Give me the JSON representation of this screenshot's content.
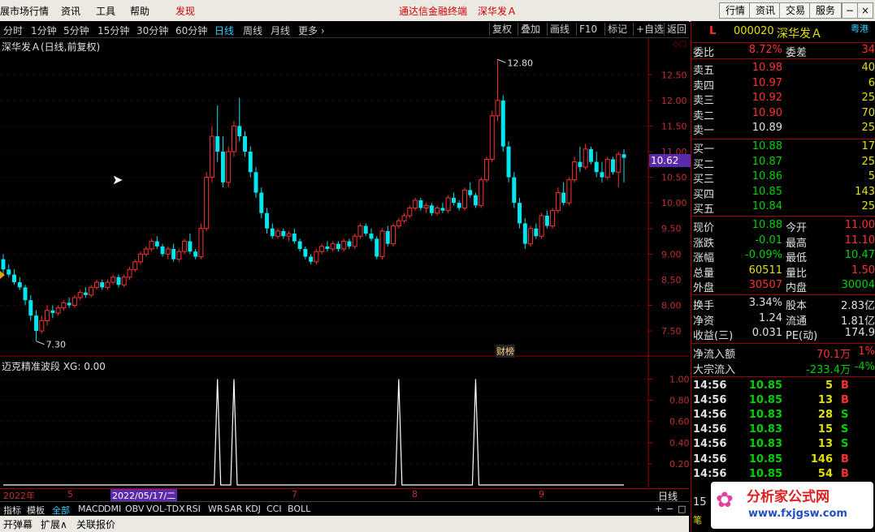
{
  "menu": {
    "items": [
      "展市场行情",
      "资讯",
      "工具",
      "帮助"
    ],
    "discover": "发现",
    "center_title": "通达信金融终端",
    "center_stock": "深华发Ａ",
    "buttons": [
      "行情",
      "资讯",
      "交易",
      "服务"
    ]
  },
  "periods": {
    "items": [
      "分时",
      "1分钟",
      "5分钟",
      "15分钟",
      "30分钟",
      "60分钟",
      "日线",
      "周线",
      "月线",
      "更多 ›"
    ],
    "active": "日线",
    "right_buttons": [
      "复权",
      "叠加",
      "画线",
      "F10",
      "标记",
      "+自选",
      "返回"
    ]
  },
  "main_chart": {
    "title": "深华发Ａ(日线,前复权)",
    "price_label": "10.62",
    "high_label": "12.80",
    "low_label": "7.30",
    "event_label": "财榜",
    "colors": {
      "up": "#ff3030",
      "down": "#00e5ee"
    }
  },
  "sub_chart": {
    "title": "迈克精准波段 XG: 0.00"
  },
  "chart_data": [
    {
      "type": "candlestick",
      "title": "深华发Ａ(日线,前复权)",
      "yticks": [
        7.5,
        8.0,
        8.5,
        9.0,
        9.5,
        10.0,
        10.5,
        11.0,
        11.5,
        12.0,
        12.5
      ],
      "ylim": [
        7.2,
        12.9
      ],
      "xticks": [
        "2022年",
        "5",
        "7",
        "8",
        "9"
      ],
      "annotations": [
        {
          "text": "12.80",
          "value": 12.8
        },
        {
          "text": "7.30",
          "value": 7.3
        },
        {
          "text": "10.62",
          "value": 10.62
        }
      ],
      "ohlc": [
        [
          8.9,
          9.0,
          8.6,
          8.7
        ],
        [
          8.7,
          8.8,
          8.55,
          8.6
        ],
        [
          8.6,
          8.7,
          8.4,
          8.45
        ],
        [
          8.45,
          8.55,
          8.3,
          8.35
        ],
        [
          8.35,
          8.4,
          8.0,
          8.1
        ],
        [
          8.1,
          8.2,
          7.7,
          7.8
        ],
        [
          7.8,
          7.9,
          7.3,
          7.5
        ],
        [
          7.5,
          7.8,
          7.45,
          7.7
        ],
        [
          7.7,
          8.0,
          7.6,
          7.9
        ],
        [
          7.9,
          8.0,
          7.75,
          7.85
        ],
        [
          7.85,
          8.0,
          7.8,
          7.95
        ],
        [
          7.95,
          8.1,
          7.9,
          8.05
        ],
        [
          8.05,
          8.15,
          7.95,
          8.0
        ],
        [
          8.0,
          8.2,
          7.95,
          8.15
        ],
        [
          8.15,
          8.3,
          8.1,
          8.25
        ],
        [
          8.25,
          8.35,
          8.15,
          8.2
        ],
        [
          8.2,
          8.4,
          8.15,
          8.35
        ],
        [
          8.35,
          8.5,
          8.3,
          8.45
        ],
        [
          8.45,
          8.5,
          8.3,
          8.35
        ],
        [
          8.35,
          8.5,
          8.3,
          8.45
        ],
        [
          8.45,
          8.6,
          8.4,
          8.55
        ],
        [
          8.55,
          8.6,
          8.35,
          8.4
        ],
        [
          8.4,
          8.6,
          8.35,
          8.55
        ],
        [
          8.55,
          8.75,
          8.5,
          8.7
        ],
        [
          8.7,
          8.9,
          8.65,
          8.85
        ],
        [
          8.85,
          9.05,
          8.8,
          9.0
        ],
        [
          9.0,
          9.15,
          8.95,
          9.1
        ],
        [
          9.1,
          9.3,
          9.05,
          9.25
        ],
        [
          9.25,
          9.35,
          9.1,
          9.15
        ],
        [
          9.15,
          9.2,
          8.95,
          9.0
        ],
        [
          9.0,
          9.15,
          8.9,
          9.1
        ],
        [
          9.1,
          9.2,
          8.85,
          8.9
        ],
        [
          8.9,
          9.1,
          8.85,
          9.05
        ],
        [
          9.05,
          9.3,
          9.0,
          9.25
        ],
        [
          9.25,
          9.4,
          9.0,
          9.05
        ],
        [
          9.05,
          9.1,
          8.9,
          8.95
        ],
        [
          8.95,
          9.6,
          8.9,
          9.5
        ],
        [
          9.5,
          10.6,
          9.45,
          10.5
        ],
        [
          10.5,
          11.5,
          10.4,
          11.3
        ],
        [
          11.3,
          11.9,
          10.8,
          11.0
        ],
        [
          11.0,
          11.3,
          10.3,
          10.4
        ],
        [
          10.4,
          11.1,
          10.3,
          11.0
        ],
        [
          11.0,
          11.6,
          10.9,
          11.5
        ],
        [
          11.5,
          12.05,
          11.2,
          11.3
        ],
        [
          11.3,
          11.4,
          10.9,
          11.0
        ],
        [
          11.0,
          11.1,
          10.5,
          10.6
        ],
        [
          10.6,
          10.7,
          10.1,
          10.2
        ],
        [
          10.2,
          10.3,
          9.7,
          9.8
        ],
        [
          9.8,
          9.9,
          9.4,
          9.5
        ],
        [
          9.5,
          9.6,
          9.3,
          9.35
        ],
        [
          9.35,
          9.5,
          9.3,
          9.45
        ],
        [
          9.45,
          9.5,
          9.3,
          9.35
        ],
        [
          9.35,
          9.45,
          9.25,
          9.4
        ],
        [
          9.4,
          9.5,
          9.2,
          9.25
        ],
        [
          9.25,
          9.3,
          9.05,
          9.1
        ],
        [
          9.1,
          9.15,
          8.9,
          8.95
        ],
        [
          8.95,
          9.0,
          8.8,
          8.85
        ],
        [
          8.85,
          9.1,
          8.8,
          9.05
        ],
        [
          9.05,
          9.2,
          9.0,
          9.15
        ],
        [
          9.15,
          9.25,
          9.05,
          9.1
        ],
        [
          9.1,
          9.25,
          9.05,
          9.2
        ],
        [
          9.2,
          9.25,
          9.05,
          9.1
        ],
        [
          9.1,
          9.3,
          9.05,
          9.25
        ],
        [
          9.25,
          9.3,
          9.1,
          9.15
        ],
        [
          9.15,
          9.4,
          9.1,
          9.35
        ],
        [
          9.35,
          9.6,
          9.3,
          9.55
        ],
        [
          9.55,
          9.6,
          9.35,
          9.4
        ],
        [
          9.4,
          9.5,
          9.25,
          9.3
        ],
        [
          9.3,
          9.35,
          8.9,
          8.95
        ],
        [
          8.95,
          9.5,
          8.9,
          9.45
        ],
        [
          9.45,
          9.55,
          9.15,
          9.2
        ],
        [
          9.2,
          9.6,
          9.15,
          9.55
        ],
        [
          9.55,
          9.7,
          9.5,
          9.65
        ],
        [
          9.65,
          9.8,
          9.6,
          9.75
        ],
        [
          9.75,
          9.95,
          9.7,
          9.9
        ],
        [
          9.9,
          10.1,
          9.85,
          10.05
        ],
        [
          10.05,
          10.1,
          9.85,
          9.9
        ],
        [
          9.9,
          10.0,
          9.8,
          9.95
        ],
        [
          9.95,
          10.0,
          9.75,
          9.8
        ],
        [
          9.8,
          9.95,
          9.75,
          9.9
        ],
        [
          9.9,
          10.0,
          9.8,
          9.85
        ],
        [
          9.85,
          10.15,
          9.8,
          10.1
        ],
        [
          10.1,
          10.2,
          9.95,
          10.0
        ],
        [
          10.0,
          10.05,
          9.85,
          9.9
        ],
        [
          9.9,
          10.3,
          9.85,
          10.25
        ],
        [
          10.25,
          10.4,
          10.1,
          10.15
        ],
        [
          10.15,
          10.2,
          9.9,
          9.95
        ],
        [
          9.95,
          10.5,
          9.9,
          10.45
        ],
        [
          10.45,
          10.9,
          10.4,
          10.85
        ],
        [
          10.85,
          11.8,
          10.8,
          11.7
        ],
        [
          11.7,
          12.8,
          11.6,
          12.0
        ],
        [
          12.0,
          12.1,
          11.0,
          11.1
        ],
        [
          11.1,
          11.2,
          10.4,
          10.5
        ],
        [
          10.5,
          10.6,
          9.9,
          10.0
        ],
        [
          10.0,
          10.1,
          9.5,
          9.6
        ],
        [
          9.6,
          9.7,
          9.1,
          9.2
        ],
        [
          9.2,
          9.55,
          9.15,
          9.5
        ],
        [
          9.5,
          9.6,
          9.3,
          9.35
        ],
        [
          9.35,
          9.8,
          9.3,
          9.75
        ],
        [
          9.75,
          9.85,
          9.5,
          9.55
        ],
        [
          9.55,
          9.9,
          9.5,
          9.85
        ],
        [
          9.85,
          10.3,
          9.8,
          10.2
        ],
        [
          10.2,
          10.4,
          9.95,
          10.0
        ],
        [
          10.0,
          10.5,
          9.95,
          10.45
        ],
        [
          10.45,
          10.9,
          10.4,
          10.8
        ],
        [
          10.8,
          11.1,
          10.6,
          10.7
        ],
        [
          10.7,
          11.15,
          10.65,
          11.05
        ],
        [
          11.05,
          11.1,
          10.75,
          10.8
        ],
        [
          10.8,
          11.0,
          10.5,
          10.6
        ],
        [
          10.6,
          10.8,
          10.4,
          10.5
        ],
        [
          10.5,
          10.9,
          10.45,
          10.85
        ],
        [
          10.85,
          10.9,
          10.55,
          10.6
        ],
        [
          10.6,
          11.0,
          10.3,
          10.95
        ],
        [
          10.95,
          11.05,
          10.4,
          10.88
        ]
      ]
    },
    {
      "type": "line",
      "title": "迈克精准波段 XG: 0.00",
      "yticks": [
        0.2,
        0.4,
        0.6,
        0.8,
        1.0
      ],
      "ylim": [
        0,
        1.05
      ],
      "spikes_at_bar": [
        39,
        42,
        72,
        86
      ],
      "values_baseline": 0
    }
  ],
  "right_panel": {
    "marker": "L",
    "code": "000020",
    "name": "深华发Ａ",
    "tag": "粤港",
    "weibi_label": "委比",
    "weibi_value": "8.72%",
    "weicha_label": "委差",
    "weicha_value": "34",
    "asks": [
      {
        "label": "卖五",
        "price": "10.98",
        "vol": "40"
      },
      {
        "label": "卖四",
        "price": "10.97",
        "vol": "6"
      },
      {
        "label": "卖三",
        "price": "10.92",
        "vol": "25"
      },
      {
        "label": "卖二",
        "price": "10.90",
        "vol": "70"
      },
      {
        "label": "卖一",
        "price": "10.89",
        "vol": "25"
      }
    ],
    "bids": [
      {
        "label": "买一",
        "price": "10.88",
        "vol": "17"
      },
      {
        "label": "买二",
        "price": "10.87",
        "vol": "25"
      },
      {
        "label": "买三",
        "price": "10.86",
        "vol": "5"
      },
      {
        "label": "买四",
        "price": "10.85",
        "vol": "143"
      },
      {
        "label": "买五",
        "price": "10.84",
        "vol": "25"
      }
    ],
    "stats": [
      {
        "l1": "现价",
        "v1": "10.88",
        "c1": "#00d000",
        "l2": "今开",
        "v2": "11.00",
        "c2": "#ff3030"
      },
      {
        "l1": "涨跌",
        "v1": "-0.01",
        "c1": "#00d000",
        "l2": "最高",
        "v2": "11.10",
        "c2": "#ff3030"
      },
      {
        "l1": "涨幅",
        "v1": "-0.09%",
        "c1": "#00d000",
        "l2": "最低",
        "v2": "10.47",
        "c2": "#00d000"
      },
      {
        "l1": "总量",
        "v1": "60511",
        "c1": "#e0e000",
        "l2": "量比",
        "v2": "1.50",
        "c2": "#ff3030"
      },
      {
        "l1": "外盘",
        "v1": "30507",
        "c1": "#ff3030",
        "l2": "内盘",
        "v2": "30004",
        "c2": "#00d000"
      }
    ],
    "stats2": [
      {
        "l1": "换手",
        "v1": "3.34%",
        "l2": "股本",
        "v2": "2.83亿"
      },
      {
        "l1": "净资",
        "v1": "1.24",
        "l2": "流通",
        "v2": "1.81亿"
      },
      {
        "l1": "收益(三)",
        "v1": "0.031",
        "l2": "PE(动)",
        "v2": "174.9"
      }
    ],
    "flow": [
      {
        "label": "净流入额",
        "value": "70.1万",
        "extra": "1%",
        "color": "#ff3030"
      },
      {
        "label": "大宗流入",
        "value": "-233.4万",
        "extra": "-4%",
        "color": "#00d000"
      }
    ],
    "ticks": [
      {
        "time": "14:56",
        "price": "10.85",
        "vol": "5",
        "side": "B"
      },
      {
        "time": "14:56",
        "price": "10.85",
        "vol": "13",
        "side": "B"
      },
      {
        "time": "14:56",
        "price": "10.83",
        "vol": "28",
        "side": "S"
      },
      {
        "time": "14:56",
        "price": "10.83",
        "vol": "15",
        "side": "S"
      },
      {
        "time": "14:56",
        "price": "10.83",
        "vol": "13",
        "side": "S"
      },
      {
        "time": "14:56",
        "price": "10.85",
        "vol": "146",
        "side": "B"
      },
      {
        "time": "14:56",
        "price": "10.85",
        "vol": "54",
        "side": "B"
      }
    ],
    "partial_time": "15",
    "partial_stub": "笔",
    "watermark_cn": "分析家公式网",
    "watermark_url": "www.fxjgsw.com"
  },
  "date_bar": {
    "year": "2022年",
    "m5": "5",
    "cursor_date": "2022/05/17/二",
    "m7": "7",
    "m8": "8",
    "m9": "9",
    "period_label": "日线",
    "zoom": [
      "+",
      "−",
      "□"
    ]
  },
  "tabs": [
    "指标",
    "模板",
    "全部",
    "MACD",
    "DMI",
    "OBV",
    "VOL-TDX",
    "RSI",
    "WR",
    "SAR",
    "KDJ",
    "CCI",
    "BOLL"
  ],
  "active_tab": "全部",
  "bottom": [
    "开弹幕",
    "扩展∧",
    "关联报价"
  ]
}
